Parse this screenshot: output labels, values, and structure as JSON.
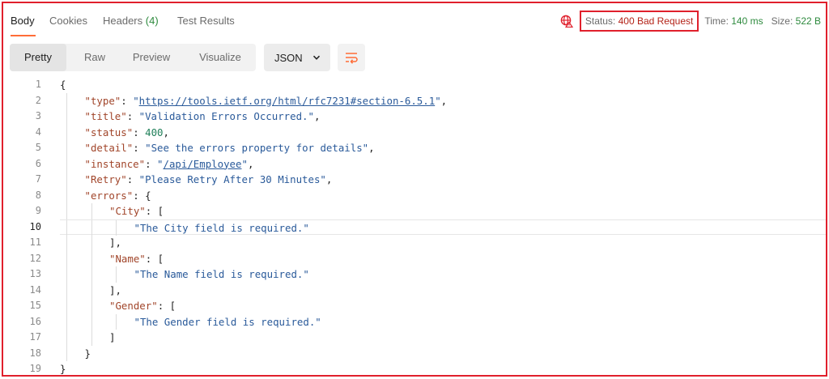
{
  "tabs": [
    {
      "label": "Body"
    },
    {
      "label": "Cookies"
    },
    {
      "label": "Headers",
      "count": "(4)"
    },
    {
      "label": "Test Results"
    }
  ],
  "status": {
    "status_label": "Status:",
    "status_value": "400 Bad Request",
    "time_label": "Time:",
    "time_value": "140 ms",
    "size_label": "Size:",
    "size_value": "522 B"
  },
  "toolbar": {
    "views": [
      "Pretty",
      "Raw",
      "Preview",
      "Visualize"
    ],
    "format": "JSON"
  },
  "colors": {
    "accent": "#ff6c37",
    "highlight_border": "#e0202c",
    "success": "#2e8a3e",
    "error": "#b42318"
  },
  "editor": {
    "current_line": 10,
    "lines": [
      {
        "n": "1",
        "indent": 0,
        "tokens": [
          {
            "t": "{",
            "c": "punc"
          }
        ]
      },
      {
        "n": "2",
        "indent": 1,
        "tokens": [
          {
            "t": "\"type\"",
            "c": "key"
          },
          {
            "t": ": ",
            "c": "punc"
          },
          {
            "t": "\"",
            "c": "str"
          },
          {
            "t": "https://tools.ietf.org/html/rfc7231#section-6.5.1",
            "c": "link"
          },
          {
            "t": "\"",
            "c": "str"
          },
          {
            "t": ",",
            "c": "punc"
          }
        ]
      },
      {
        "n": "3",
        "indent": 1,
        "tokens": [
          {
            "t": "\"title\"",
            "c": "key"
          },
          {
            "t": ": ",
            "c": "punc"
          },
          {
            "t": "\"Validation Errors Occurred.\"",
            "c": "str"
          },
          {
            "t": ",",
            "c": "punc"
          }
        ]
      },
      {
        "n": "4",
        "indent": 1,
        "tokens": [
          {
            "t": "\"status\"",
            "c": "key"
          },
          {
            "t": ": ",
            "c": "punc"
          },
          {
            "t": "400",
            "c": "num"
          },
          {
            "t": ",",
            "c": "punc"
          }
        ]
      },
      {
        "n": "5",
        "indent": 1,
        "tokens": [
          {
            "t": "\"detail\"",
            "c": "key"
          },
          {
            "t": ": ",
            "c": "punc"
          },
          {
            "t": "\"See the errors property for details\"",
            "c": "str"
          },
          {
            "t": ",",
            "c": "punc"
          }
        ]
      },
      {
        "n": "6",
        "indent": 1,
        "tokens": [
          {
            "t": "\"instance\"",
            "c": "key"
          },
          {
            "t": ": ",
            "c": "punc"
          },
          {
            "t": "\"",
            "c": "str"
          },
          {
            "t": "/api/Employee",
            "c": "link"
          },
          {
            "t": "\"",
            "c": "str"
          },
          {
            "t": ",",
            "c": "punc"
          }
        ]
      },
      {
        "n": "7",
        "indent": 1,
        "tokens": [
          {
            "t": "\"Retry\"",
            "c": "key"
          },
          {
            "t": ": ",
            "c": "punc"
          },
          {
            "t": "\"Please Retry After 30 Minutes\"",
            "c": "str"
          },
          {
            "t": ",",
            "c": "punc"
          }
        ]
      },
      {
        "n": "8",
        "indent": 1,
        "tokens": [
          {
            "t": "\"errors\"",
            "c": "key"
          },
          {
            "t": ": {",
            "c": "punc"
          }
        ]
      },
      {
        "n": "9",
        "indent": 2,
        "tokens": [
          {
            "t": "\"City\"",
            "c": "key"
          },
          {
            "t": ": [",
            "c": "punc"
          }
        ]
      },
      {
        "n": "10",
        "indent": 3,
        "tokens": [
          {
            "t": "\"The City field is required.\"",
            "c": "str"
          }
        ]
      },
      {
        "n": "11",
        "indent": 2,
        "tokens": [
          {
            "t": "],",
            "c": "punc"
          }
        ]
      },
      {
        "n": "12",
        "indent": 2,
        "tokens": [
          {
            "t": "\"Name\"",
            "c": "key"
          },
          {
            "t": ": [",
            "c": "punc"
          }
        ]
      },
      {
        "n": "13",
        "indent": 3,
        "tokens": [
          {
            "t": "\"The Name field is required.\"",
            "c": "str"
          }
        ]
      },
      {
        "n": "14",
        "indent": 2,
        "tokens": [
          {
            "t": "],",
            "c": "punc"
          }
        ]
      },
      {
        "n": "15",
        "indent": 2,
        "tokens": [
          {
            "t": "\"Gender\"",
            "c": "key"
          },
          {
            "t": ": [",
            "c": "punc"
          }
        ]
      },
      {
        "n": "16",
        "indent": 3,
        "tokens": [
          {
            "t": "\"The Gender field is required.\"",
            "c": "str"
          }
        ]
      },
      {
        "n": "17",
        "indent": 2,
        "tokens": [
          {
            "t": "]",
            "c": "punc"
          }
        ]
      },
      {
        "n": "18",
        "indent": 1,
        "tokens": [
          {
            "t": "}",
            "c": "punc"
          }
        ]
      },
      {
        "n": "19",
        "indent": 0,
        "tokens": [
          {
            "t": "}",
            "c": "punc"
          }
        ]
      }
    ]
  }
}
